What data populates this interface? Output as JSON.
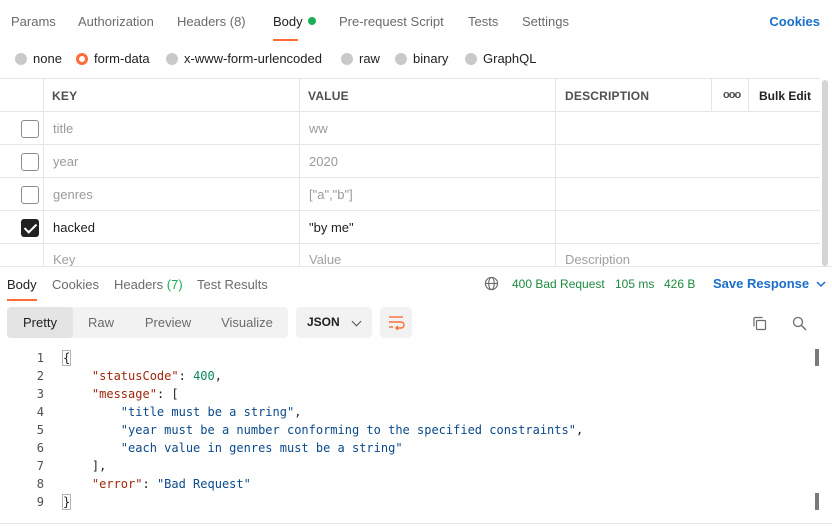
{
  "request_tabs": [
    {
      "label": "Params"
    },
    {
      "label": "Authorization"
    },
    {
      "label": "Headers (8)"
    },
    {
      "label": "Body"
    },
    {
      "label": "Pre-request Script"
    },
    {
      "label": "Tests"
    },
    {
      "label": "Settings"
    }
  ],
  "cookies_label": "Cookies",
  "body_types": [
    {
      "label": "none"
    },
    {
      "label": "form-data"
    },
    {
      "label": "x-www-form-urlencoded"
    },
    {
      "label": "raw"
    },
    {
      "label": "binary"
    },
    {
      "label": "GraphQL"
    }
  ],
  "selected_body_type": "form-data",
  "table": {
    "headers": {
      "key": "KEY",
      "value": "VALUE",
      "description": "DESCRIPTION"
    },
    "more_label": "ooo",
    "bulk_edit": "Bulk Edit",
    "rows": [
      {
        "key": "title",
        "value": "ww",
        "checked": false
      },
      {
        "key": "year",
        "value": "2020",
        "checked": false
      },
      {
        "key": "genres",
        "value": "[\"a\",\"b\"]",
        "checked": false
      },
      {
        "key": "hacked",
        "value": "\"by me\"",
        "checked": true
      }
    ],
    "placeholders": {
      "key": "Key",
      "value": "Value",
      "description": "Description"
    }
  },
  "response_tabs": [
    {
      "label": "Body",
      "count": ""
    },
    {
      "label": "Cookies",
      "count": ""
    },
    {
      "label": "Headers",
      "count": "(7)"
    },
    {
      "label": "Test Results",
      "count": ""
    }
  ],
  "response_status": {
    "status": "400 Bad Request",
    "time": "105 ms",
    "size": "426 B"
  },
  "save_response": "Save Response",
  "view_modes": [
    {
      "label": "Pretty"
    },
    {
      "label": "Raw"
    },
    {
      "label": "Preview"
    },
    {
      "label": "Visualize"
    }
  ],
  "format": "JSON",
  "code_lines": [
    "1",
    "2",
    "3",
    "4",
    "5",
    "6",
    "7",
    "8",
    "9"
  ],
  "code": {
    "statusCode_key": "\"statusCode\"",
    "statusCode_val": "400",
    "message_key": "\"message\"",
    "msg1": "\"title must be a string\"",
    "msg2": "\"year must be a number conforming to the specified constraints\"",
    "msg3": "\"each value in genres must be a string\"",
    "error_key": "\"error\"",
    "error_val": "\"Bad Request\""
  },
  "colors": {
    "accent": "#ff6c37",
    "success": "#1aaf54",
    "link": "#1a6ec7"
  }
}
